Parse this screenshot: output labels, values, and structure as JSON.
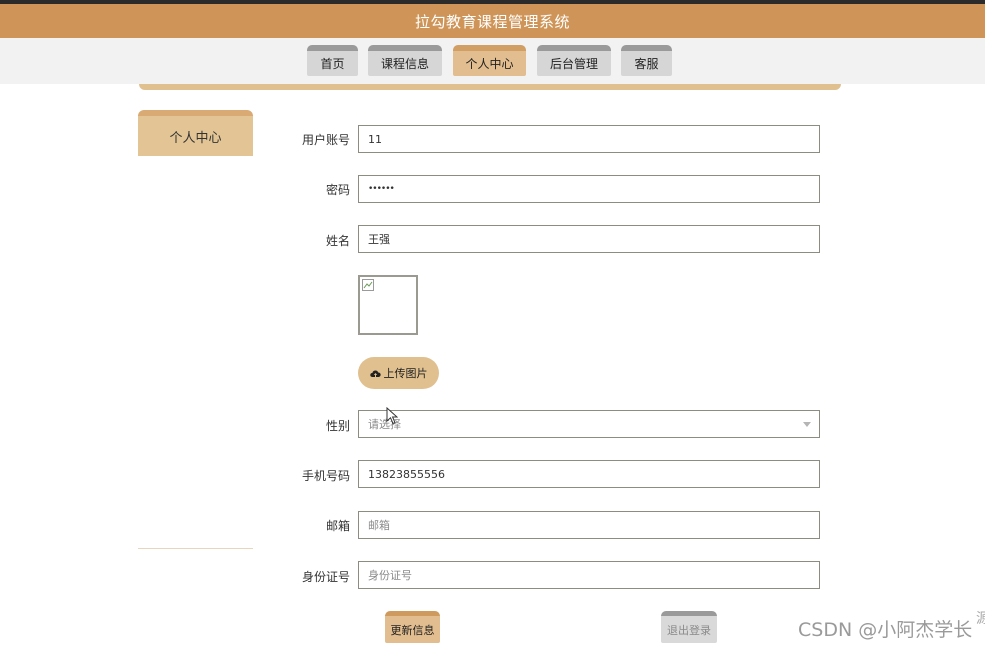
{
  "header": {
    "title": "拉勾教育课程管理系统"
  },
  "nav": {
    "items": [
      {
        "label": "首页"
      },
      {
        "label": "课程信息"
      },
      {
        "label": "个人中心"
      },
      {
        "label": "后台管理"
      },
      {
        "label": "客服"
      }
    ],
    "active_index": 2
  },
  "sidebar": {
    "tab_label": "个人中心"
  },
  "form": {
    "username": {
      "label": "用户账号",
      "value": "11"
    },
    "password": {
      "label": "密码",
      "value": "••••••"
    },
    "name": {
      "label": "姓名",
      "value": "王强"
    },
    "avatar": {
      "icon": "broken-image-icon"
    },
    "upload": {
      "label": "上传图片",
      "icon": "cloud-upload-icon"
    },
    "gender": {
      "label": "性别",
      "placeholder": "请选择"
    },
    "phone": {
      "label": "手机号码",
      "value": "13823855556"
    },
    "email": {
      "label": "邮箱",
      "placeholder": "邮箱"
    },
    "id_card": {
      "label": "身份证号",
      "placeholder": "身份证号"
    }
  },
  "actions": {
    "update_label": "更新信息",
    "logout_label": "退出登录"
  },
  "watermark": {
    "text": "CSDN @小阿杰学长",
    "edge_text": "源"
  },
  "colors": {
    "header_bg": "#cf9558",
    "accent_tan": "#e2bd8f",
    "nav_inactive": "#d6d6d6",
    "border": "#8c8c80"
  }
}
